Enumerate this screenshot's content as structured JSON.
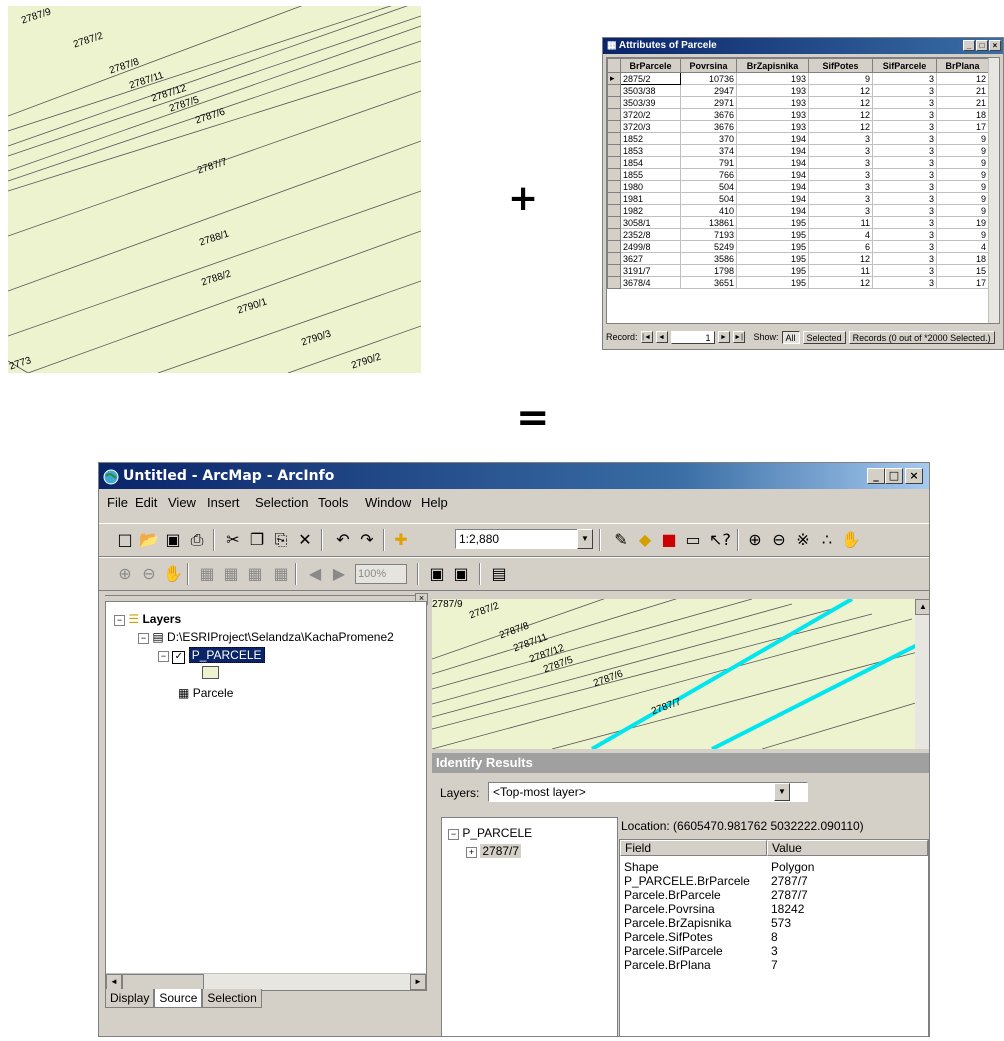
{
  "operators": {
    "plus": "+",
    "equals": "="
  },
  "map_top": {
    "labels": [
      "2787/9",
      "2787/2",
      "2787/8",
      "2787/11",
      "2787/12",
      "2787/5",
      "2787/6",
      "2787/7",
      "2788/1",
      "2788/2",
      "2790/1",
      "2790/3",
      "2790/2",
      "2773"
    ]
  },
  "attribute_table": {
    "title": "Attributes of Parcele",
    "columns": [
      "BrParcele",
      "Povrsina",
      "BrZapisnika",
      "SifPotes",
      "SifParcele",
      "BrPlana"
    ],
    "rows": [
      [
        "2875/2",
        "10736",
        "193",
        "9",
        "3",
        "12"
      ],
      [
        "3503/38",
        "2947",
        "193",
        "12",
        "3",
        "21"
      ],
      [
        "3503/39",
        "2971",
        "193",
        "12",
        "3",
        "21"
      ],
      [
        "3720/2",
        "3676",
        "193",
        "12",
        "3",
        "18"
      ],
      [
        "3720/3",
        "3676",
        "193",
        "12",
        "3",
        "17"
      ],
      [
        "1852",
        "370",
        "194",
        "3",
        "3",
        "9"
      ],
      [
        "1853",
        "374",
        "194",
        "3",
        "3",
        "9"
      ],
      [
        "1854",
        "791",
        "194",
        "3",
        "3",
        "9"
      ],
      [
        "1855",
        "766",
        "194",
        "3",
        "3",
        "9"
      ],
      [
        "1980",
        "504",
        "194",
        "3",
        "3",
        "9"
      ],
      [
        "1981",
        "504",
        "194",
        "3",
        "3",
        "9"
      ],
      [
        "1982",
        "410",
        "194",
        "3",
        "3",
        "9"
      ],
      [
        "3058/1",
        "13861",
        "195",
        "11",
        "3",
        "19"
      ],
      [
        "2352/8",
        "7193",
        "195",
        "4",
        "3",
        "9"
      ],
      [
        "2499/8",
        "5249",
        "195",
        "6",
        "3",
        "4"
      ],
      [
        "3627",
        "3586",
        "195",
        "12",
        "3",
        "18"
      ],
      [
        "3191/7",
        "1798",
        "195",
        "11",
        "3",
        "15"
      ],
      [
        "3678/4",
        "3651",
        "195",
        "12",
        "3",
        "17"
      ]
    ],
    "footer": {
      "record_label": "Record:",
      "record_value": "1",
      "show_label": "Show:",
      "all_btn": "All",
      "selected_btn": "Selected",
      "records_text": "Records (0 out of *2000 Selected.)"
    }
  },
  "arcmap": {
    "title": "Untitled - ArcMap - ArcInfo",
    "menu": [
      "File",
      "Edit",
      "View",
      "Insert",
      "Selection",
      "Tools",
      "Window",
      "Help"
    ],
    "scale": "1:2,880",
    "zoom_pct": "100%",
    "toc": {
      "layers_label": "Layers",
      "path": "D:\\ESRIProject\\Selandza\\KachaPromene2",
      "layer_name": "P_PARCELE",
      "table_name": "Parcele"
    },
    "tabs": [
      "Display",
      "Source",
      "Selection"
    ],
    "map_labels": [
      "2787/9",
      "2787/2",
      "2787/8",
      "2787/11",
      "2787/12",
      "2787/5",
      "2787/6",
      "2787/7"
    ],
    "identify": {
      "title": "Identify Results",
      "layers_label": "Layers:",
      "layers_value": "<Top-most layer>",
      "tree_root": "P_PARCELE",
      "tree_child": "2787/7",
      "location": "Location: (6605470.981762  5032222.090110)",
      "field_header": "Field",
      "value_header": "Value",
      "rows": [
        [
          "Shape",
          "Polygon"
        ],
        [
          "P_PARCELE.BrParcele",
          "2787/7"
        ],
        [
          "Parcele.BrParcele",
          "2787/7"
        ],
        [
          "Parcele.Povrsina",
          "18242"
        ],
        [
          "Parcele.BrZapisnika",
          "573"
        ],
        [
          "Parcele.SifPotes",
          "8"
        ],
        [
          "Parcele.SifParcele",
          "3"
        ],
        [
          "Parcele.BrPlana",
          "7"
        ]
      ]
    }
  }
}
